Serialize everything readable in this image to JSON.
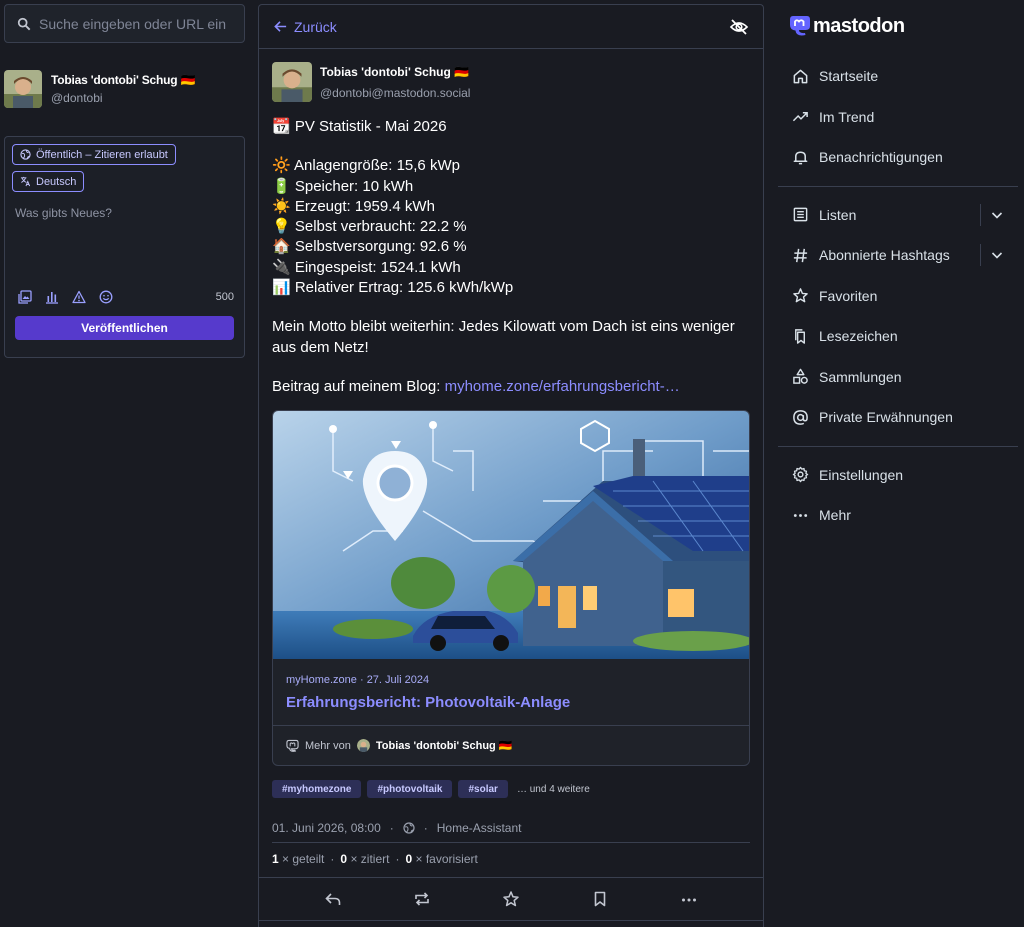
{
  "search": {
    "placeholder": "Suche eingeben oder URL ein"
  },
  "me": {
    "name": "Tobias 'dontobi' Schug 🇩🇪",
    "handle": "@dontobi"
  },
  "compose": {
    "visibility": "Öffentlich – Zitieren erlaubt",
    "language": "Deutsch",
    "placeholder": "Was gibts Neues?",
    "char_count": "500",
    "publish_label": "Veröffentlichen"
  },
  "topbar": {
    "back_label": "Zurück"
  },
  "status": {
    "author_name": "Tobias 'dontobi' Schug 🇩🇪",
    "author_handle": "@dontobi@mastodon.social",
    "lines_block1": [
      "📆 PV Statistik - Mai 2026"
    ],
    "lines_block2": [
      "🔆 Anlagengröße: 15,6 kWp",
      "🔋 Speicher: 10 kWh",
      "☀️ Erzeugt: 1959.4 kWh",
      "💡 Selbst verbraucht: 22.2 %",
      "🏠 Selbstversorgung: 92.6 %",
      "🔌 Eingespeist: 1524.1 kWh",
      "📊 Relativer Ertrag: 125.6 kWh/kWp"
    ],
    "motto": "Mein Motto bleibt weiterhin: Jedes Kilowatt vom Dach ist eins weniger aus dem Netz!",
    "blog_prefix": "Beitrag auf meinem Blog: ",
    "blog_link": "myhome.zone/erfahrungsbericht-…",
    "card": {
      "meta": "myHome.zone · 27. Juli 2024",
      "title": "Erfahrungsbericht: Photovoltaik-Anlage",
      "more_prefix": "Mehr von",
      "more_author": "Tobias 'dontobi' Schug 🇩🇪"
    },
    "tags": [
      "#myhomezone",
      "#photovoltaik",
      "#solar"
    ],
    "tags_more": "… und 4 weitere",
    "date": "01. Juni 2026, 08:00",
    "dot": "·",
    "app": "Home-Assistant",
    "stats": {
      "boosts": "1",
      "boosts_label": "× geteilt",
      "quotes": "0",
      "quotes_label": "× zitiert",
      "favs": "0",
      "favs_label": "× favorisiert"
    }
  },
  "brand": {
    "name": "mastodon",
    "accent": "#8c8dff",
    "button": "#563acc"
  },
  "nav": {
    "home": "Startseite",
    "trending": "Im Trend",
    "notifications": "Benachrichtigungen",
    "lists": "Listen",
    "hashtags": "Abonnierte Hashtags",
    "favourites": "Favoriten",
    "bookmarks": "Lesezeichen",
    "collections": "Sammlungen",
    "mentions": "Private Erwähnungen",
    "settings": "Einstellungen",
    "more": "Mehr"
  }
}
